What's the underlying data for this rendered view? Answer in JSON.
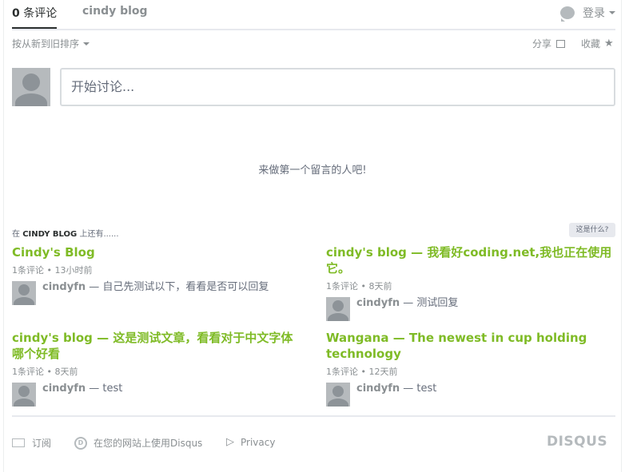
{
  "nav": {
    "count_number": "0",
    "count_label": " 条评论",
    "forum_name": "cindy blog",
    "login_label": "登录"
  },
  "toolbar": {
    "sort_label": "按从新到旧排序",
    "share_label": "分享",
    "favorite_label": "收藏"
  },
  "composer": {
    "placeholder": "开始讨论..."
  },
  "empty_message": "来做第一个留言的人吧!",
  "also_on": {
    "prefix": "在 ",
    "site": "CINDY BLOG",
    "suffix": " 上还有......",
    "whats_this": "这是什么?"
  },
  "recommendations": [
    {
      "title": "Cindy's Blog",
      "comments": "1条评论",
      "age": "13小时前",
      "user": "cindyfn",
      "excerpt": " — 自己先测试以下，看看是否可以回复"
    },
    {
      "title": "cindy's blog — 我看好coding.net,我也正在使用它。",
      "comments": "1条评论",
      "age": "8天前",
      "user": "cindyfn",
      "excerpt": " — 测试回复"
    },
    {
      "title": "cindy's blog — 这是测试文章，看看对于中文字体哪个好看",
      "comments": "1条评论",
      "age": "8天前",
      "user": "cindyfn",
      "excerpt": " — test"
    },
    {
      "title": "Wangana — The newest in cup holding technology",
      "comments": "1条评论",
      "age": "12天前",
      "user": "cindyfn",
      "excerpt": " — test"
    }
  ],
  "footer": {
    "subscribe": "订阅",
    "use_disqus": "在您的网站上使用Disqus",
    "privacy": "Privacy",
    "logo": "DISQUS"
  },
  "colors": {
    "accent_green": "#7fbb26",
    "muted": "#8a8f92"
  }
}
